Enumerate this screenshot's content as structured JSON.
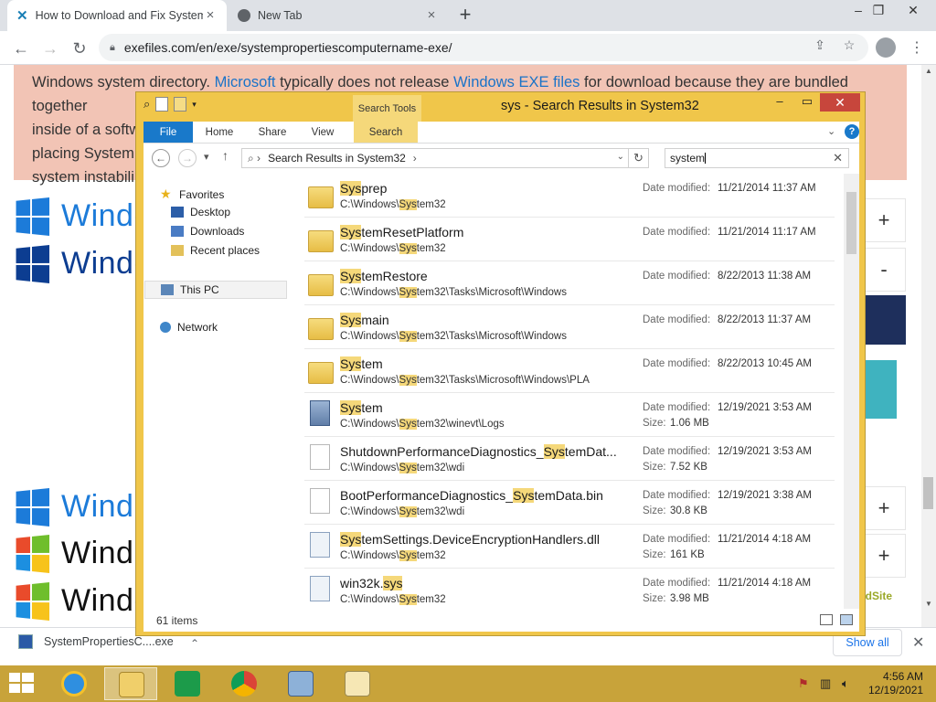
{
  "browser": {
    "tabs": [
      {
        "title": "How to Download and Fix System",
        "active": true
      },
      {
        "title": "New Tab",
        "active": false
      }
    ],
    "url": "exefiles.com/en/exe/systempropertiescomputername-exe/"
  },
  "webpage": {
    "article": {
      "line1_a": "Windows system directory. ",
      "link1": "Microsoft",
      "line1_b": " typically does not release ",
      "link2": "Windows EXE files",
      "line1_c": " for download because they are bundled together",
      "line2": "inside of a softw",
      "line3": "placing SystemP",
      "line4": "system instabili"
    },
    "windows_logos": [
      "Windo",
      "Windo",
      "Wind",
      "Wind",
      "Windo"
    ],
    "side_buttons": [
      "+",
      "-",
      "+",
      "+"
    ],
    "badge_text": "edSite"
  },
  "download_shelf": {
    "filename": "SystemPropertiesC....exe",
    "show_all": "Show all"
  },
  "explorer": {
    "title": "sys - Search Results in System32",
    "contextual_group": "Search Tools",
    "ribbon_tabs": [
      "File",
      "Home",
      "Share",
      "View",
      "Search"
    ],
    "address": "Search Results in System32",
    "search_query": "system",
    "nav": {
      "favorites": "Favorites",
      "desktop": "Desktop",
      "downloads": "Downloads",
      "recent": "Recent places",
      "this_pc": "This PC",
      "network": "Network"
    },
    "labels": {
      "date_modified": "Date modified:",
      "size": "Size:"
    },
    "results": [
      {
        "icon": "folder",
        "name_hl": "Sys",
        "name_rest": "prep",
        "path_a": "C:\\Windows\\",
        "path_hl": "Sys",
        "path_b": "tem32",
        "date": "11/21/2014 11:37 AM"
      },
      {
        "icon": "folder",
        "name_hl": "Sys",
        "name_rest": "temResetPlatform",
        "path_a": "C:\\Windows\\",
        "path_hl": "Sys",
        "path_b": "tem32",
        "date": "11/21/2014 11:17 AM"
      },
      {
        "icon": "folder",
        "name_hl": "Sys",
        "name_rest": "temRestore",
        "path_a": "C:\\Windows\\",
        "path_hl": "Sys",
        "path_b": "tem32\\Tasks\\Microsoft\\Windows",
        "date": "8/22/2013 11:38 AM"
      },
      {
        "icon": "folder",
        "name_hl": "Sys",
        "name_rest": "main",
        "path_a": "C:\\Windows\\",
        "path_hl": "Sys",
        "path_b": "tem32\\Tasks\\Microsoft\\Windows",
        "date": "8/22/2013 11:37 AM"
      },
      {
        "icon": "folder",
        "name_hl": "Sys",
        "name_rest": "tem",
        "path_a": "C:\\Windows\\",
        "path_hl": "Sys",
        "path_b": "tem32\\Tasks\\Microsoft\\Windows\\PLA",
        "date": "8/22/2013 10:45 AM"
      },
      {
        "icon": "evtx",
        "name_hl": "Sys",
        "name_rest": "tem",
        "path_a": "C:\\Windows\\",
        "path_hl": "Sys",
        "path_b": "tem32\\winevt\\Logs",
        "date": "12/19/2021 3:53 AM",
        "size": "1.06 MB"
      },
      {
        "icon": "doc",
        "name_pre": "ShutdownPerformanceDiagnostics_",
        "name_hl": "Sys",
        "name_rest": "temDat...",
        "path_a": "C:\\Windows\\",
        "path_hl": "Sys",
        "path_b": "tem32\\wdi",
        "date": "12/19/2021 3:53 AM",
        "size": "7.52 KB"
      },
      {
        "icon": "doc",
        "name_pre": "BootPerformanceDiagnostics_",
        "name_hl": "Sys",
        "name_rest": "temData.bin",
        "path_a": "C:\\Windows\\",
        "path_hl": "Sys",
        "path_b": "tem32\\wdi",
        "date": "12/19/2021 3:38 AM",
        "size": "30.8 KB"
      },
      {
        "icon": "dll",
        "name_hl": "Sys",
        "name_rest": "temSettings.DeviceEncryptionHandlers.dll",
        "path_a": "C:\\Windows\\",
        "path_hl": "Sys",
        "path_b": "tem32",
        "date": "11/21/2014 4:18 AM",
        "size": "161 KB"
      },
      {
        "icon": "dll",
        "name_pre": "win32k.",
        "name_hl": "sys",
        "name_rest": "",
        "path_a": "C:\\Windows\\",
        "path_hl": "Sys",
        "path_b": "tem32",
        "date": "11/21/2014 4:18 AM",
        "size": "3.98 MB"
      }
    ],
    "status": "61 items"
  },
  "taskbar": {
    "time": "4:56 AM",
    "date": "12/19/2021"
  },
  "colors": {
    "explorer_frame": "#f0c64a",
    "highlight": "#f5d87a",
    "taskbar": "#c8a33a",
    "article_bg": "#f2c4b5",
    "link": "#1a73c8"
  }
}
